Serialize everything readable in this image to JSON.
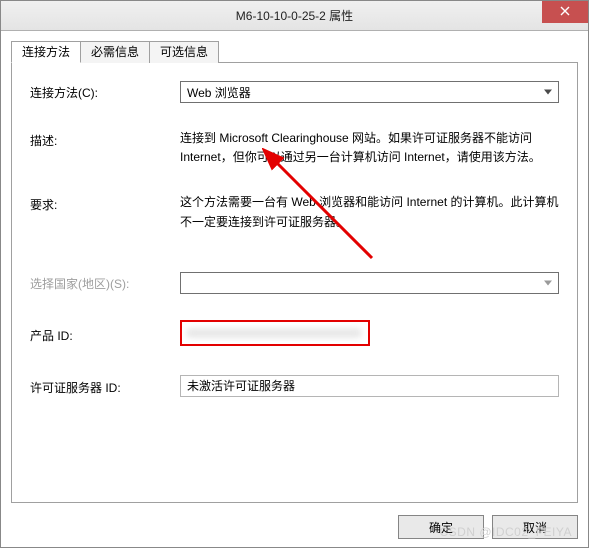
{
  "window": {
    "title": "M6-10-10-0-25-2 属性"
  },
  "tabs": [
    {
      "label": "连接方法",
      "active": true
    },
    {
      "label": "必需信息",
      "active": false
    },
    {
      "label": "可选信息",
      "active": false
    }
  ],
  "form": {
    "method_label": "连接方法(C):",
    "method_value": "Web 浏览器",
    "description_label": "描述:",
    "description_value": "连接到 Microsoft Clearinghouse 网站。如果许可证服务器不能访问 Internet，但你可以通过另一台计算机访问 Internet，请使用该方法。",
    "requirement_label": "要求:",
    "requirement_value": "这个方法需要一台有 Web 浏览器和能访问 Internet 的计算机。此计算机不一定要连接到许可证服务器。",
    "country_label": "选择国家(地区)(S):",
    "country_value": "",
    "product_label": "产品 ID:",
    "server_label": "许可证服务器 ID:",
    "server_value": "未激活许可证服务器"
  },
  "buttons": {
    "ok": "确定",
    "cancel": "取消"
  },
  "watermark": "CSDN @IDC02_FEIYA",
  "annotation": {
    "arrow_color": "#e30000"
  }
}
